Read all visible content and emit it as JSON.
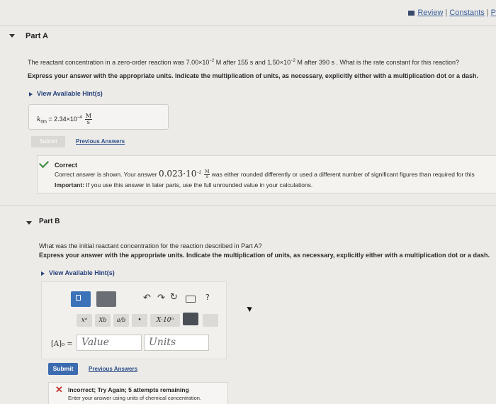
{
  "header": {
    "review_label": "Review",
    "separator": "|",
    "constants_label": "Constants",
    "cut_label": "P"
  },
  "part_a": {
    "label": "Part A",
    "question_pre": "The reactant concentration in a zero-order reaction was 7.00×10",
    "question_exp1": "−2",
    "question_mid1": " M after 155 s and 1.50×10",
    "question_exp2": "−2",
    "question_post": " M after 390 s . What is the rate constant for this reaction?",
    "instruction": "Express your answer with the appropriate units. Indicate the multiplication of units, as necessary, explicitly either with a multiplication dot or a dash.",
    "hint_label": "View Available Hint(s)",
    "answer_symbol": "k",
    "answer_subscript": "0th",
    "answer_value": " = 2.34×10",
    "answer_exp": "−4",
    "answer_unit_num": "M",
    "answer_unit_den": "s",
    "submit_label": "Submit",
    "previous_answers_label": "Previous Answers",
    "feedback": {
      "title": "Correct",
      "line1_pre": "Correct answer is shown. Your answer ",
      "line1_value": "0.023·10",
      "line1_exp": "−2",
      "line1_unit_num": "M",
      "line1_unit_den": "s",
      "line1_post": " was either rounded differently or used a different number of significant figures than required for this",
      "important_bold": "Important:",
      "important_text": " If you use this answer in later parts, use the full unrounded value in your calculations."
    }
  },
  "part_b": {
    "label": "Part B",
    "question": "What was the initial reactant concentration for the reaction described in Part A?",
    "instruction": "Express your answer with the appropriate units. Indicate the multiplication of units, as necessary, explicitly either with a multiplication dot or a dash.",
    "hint_label": "View Available Hint(s)",
    "toolbar": {
      "x_power": "xᵃ",
      "x_sub": "Xb",
      "fraction": "a/b",
      "dot": "•",
      "sci": "X·10ⁿ",
      "help": "?"
    },
    "input_label": "[A]₀ =",
    "value_placeholder": "Value",
    "units_placeholder": "Units",
    "submit_label": "Submit",
    "previous_answers_label": "Previous Answers",
    "feedback": {
      "title": "Incorrect; Try Again; 5 attempts remaining",
      "message": "Enter your answer using units of chemical concentration."
    }
  },
  "colors": {
    "link": "#2d4f8a",
    "primary_button": "#3d6bb0",
    "correct": "#3c8a3c",
    "incorrect": "#c0322b"
  }
}
